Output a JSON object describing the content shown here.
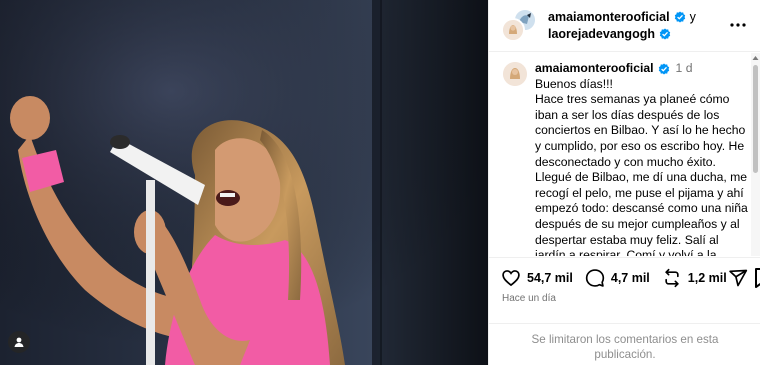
{
  "post": {
    "author": "amaiamonterooficial",
    "conjunction": "y",
    "collaborator": "laorejadevangogh",
    "time_ago": "1 d",
    "caption": "Buenos días!!!\nHace tres semanas ya planeé cómo iban a ser los días después de los conciertos en Bilbao. Y así lo he hecho y cumplido, por eso os escribo hoy. He desconectado y con mucho éxito.\nLlegué de Bilbao, me dí una ducha, me recogí el pelo, me puse el pijama y ahí empezó todo: descansé como una niña después de su mejor cumpleaños y al despertar estaba muy feliz. Salí al jardín a respirar. Comí y volví a la",
    "likes": "54,7 mil",
    "comments": "4,7 mil",
    "reposts": "1,2 mil",
    "timestamp": "Hace un día",
    "comments_disabled": "Se limitaron los comentarios en esta publicación."
  },
  "icons": {
    "like": "heart-icon",
    "comment": "comment-icon",
    "repost": "repost-icon",
    "share": "share-icon",
    "save": "bookmark-icon",
    "more": "more-options-icon",
    "verified": "verified-badge-icon",
    "tag": "user-tag-icon"
  },
  "colors": {
    "verified": "#0095f6",
    "muted": "#737373",
    "dress": "#f25ca5"
  }
}
